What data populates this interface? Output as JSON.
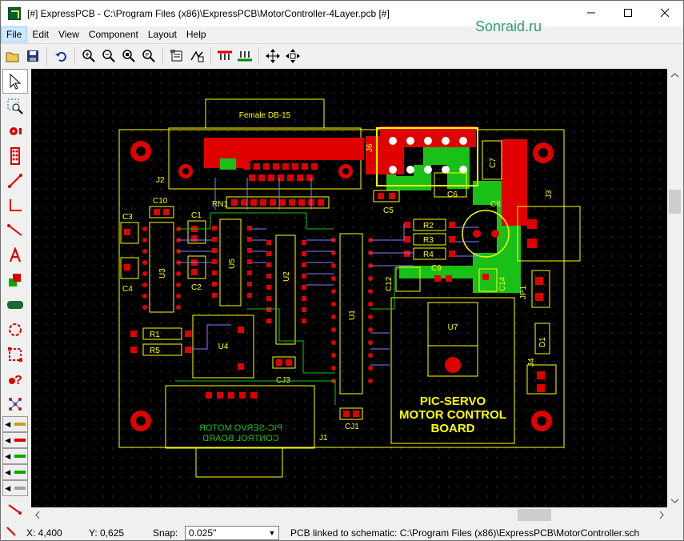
{
  "window": {
    "title": "[#] ExpressPCB - C:\\Program Files (x86)\\ExpressPCB\\MotorController-4Layer.pcb [#]",
    "watermark": "Sonraid.ru"
  },
  "menu": [
    "File",
    "Edit",
    "View",
    "Component",
    "Layout",
    "Help"
  ],
  "board": {
    "connector_top": "Female DB-15",
    "j2": "J2",
    "j6": "J6",
    "j3": "J3",
    "j1": "J1",
    "j4": "J4",
    "rn1": "RN1",
    "c10": "C10",
    "c3": "C3",
    "c4": "C4",
    "c1": "C1",
    "c2": "C2",
    "c5": "C5",
    "c6": "C6",
    "c7": "C7",
    "c8": "C8",
    "c9": "C9",
    "c12": "C12",
    "c14": "C14",
    "cj1": "CJ1",
    "cj3": "CJ3",
    "r1": "R1",
    "r2": "R2",
    "r3": "R3",
    "r4": "R4",
    "r5": "R5",
    "u1": "U1",
    "u2": "U2",
    "u3": "U3",
    "u4": "U4",
    "u5": "U5",
    "u7": "U7",
    "d1": "D1",
    "jp1": "JP1",
    "silk_line1": "PIC-SERVO",
    "silk_line2": "MOTOR CONTROL",
    "silk_line3": "BOARD",
    "mirror_line1": "PIC-SERVO MOTOR",
    "mirror_line2": "CONTROL BOARD"
  },
  "status": {
    "x": "X: 4,400",
    "y": "Y: 0,625",
    "snap_label": "Snap:",
    "snap_value": "0.025\"",
    "link": "PCB linked to schematic:  C:\\Program Files (x86)\\ExpressPCB\\MotorController.sch"
  },
  "colors": {
    "canvas": "#000000",
    "silk": "#ffff00",
    "top_copper": "#ff0000",
    "bottom_copper": "#18c018",
    "inner": "#8080ff"
  }
}
